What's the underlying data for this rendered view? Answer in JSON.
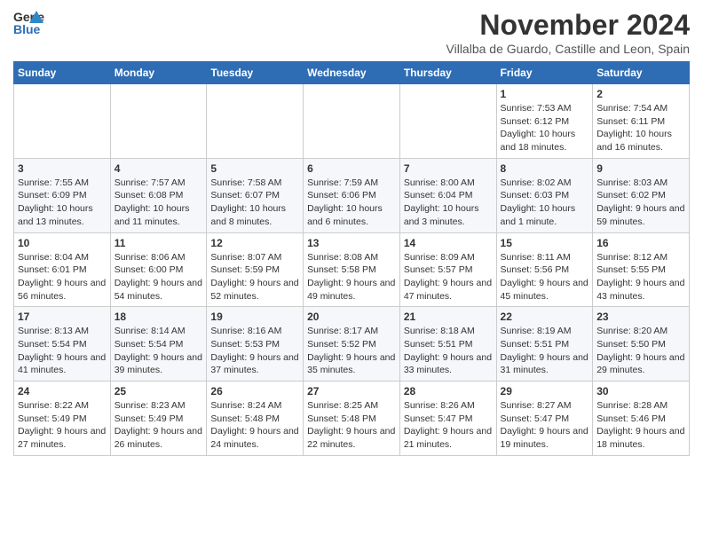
{
  "header": {
    "logo_general": "General",
    "logo_blue": "Blue",
    "title": "November 2024",
    "subtitle": "Villalba de Guardo, Castille and Leon, Spain"
  },
  "calendar": {
    "weekdays": [
      "Sunday",
      "Monday",
      "Tuesday",
      "Wednesday",
      "Thursday",
      "Friday",
      "Saturday"
    ],
    "weeks": [
      [
        {
          "day": "",
          "info": ""
        },
        {
          "day": "",
          "info": ""
        },
        {
          "day": "",
          "info": ""
        },
        {
          "day": "",
          "info": ""
        },
        {
          "day": "",
          "info": ""
        },
        {
          "day": "1",
          "info": "Sunrise: 7:53 AM\nSunset: 6:12 PM\nDaylight: 10 hours and 18 minutes."
        },
        {
          "day": "2",
          "info": "Sunrise: 7:54 AM\nSunset: 6:11 PM\nDaylight: 10 hours and 16 minutes."
        }
      ],
      [
        {
          "day": "3",
          "info": "Sunrise: 7:55 AM\nSunset: 6:09 PM\nDaylight: 10 hours and 13 minutes."
        },
        {
          "day": "4",
          "info": "Sunrise: 7:57 AM\nSunset: 6:08 PM\nDaylight: 10 hours and 11 minutes."
        },
        {
          "day": "5",
          "info": "Sunrise: 7:58 AM\nSunset: 6:07 PM\nDaylight: 10 hours and 8 minutes."
        },
        {
          "day": "6",
          "info": "Sunrise: 7:59 AM\nSunset: 6:06 PM\nDaylight: 10 hours and 6 minutes."
        },
        {
          "day": "7",
          "info": "Sunrise: 8:00 AM\nSunset: 6:04 PM\nDaylight: 10 hours and 3 minutes."
        },
        {
          "day": "8",
          "info": "Sunrise: 8:02 AM\nSunset: 6:03 PM\nDaylight: 10 hours and 1 minute."
        },
        {
          "day": "9",
          "info": "Sunrise: 8:03 AM\nSunset: 6:02 PM\nDaylight: 9 hours and 59 minutes."
        }
      ],
      [
        {
          "day": "10",
          "info": "Sunrise: 8:04 AM\nSunset: 6:01 PM\nDaylight: 9 hours and 56 minutes."
        },
        {
          "day": "11",
          "info": "Sunrise: 8:06 AM\nSunset: 6:00 PM\nDaylight: 9 hours and 54 minutes."
        },
        {
          "day": "12",
          "info": "Sunrise: 8:07 AM\nSunset: 5:59 PM\nDaylight: 9 hours and 52 minutes."
        },
        {
          "day": "13",
          "info": "Sunrise: 8:08 AM\nSunset: 5:58 PM\nDaylight: 9 hours and 49 minutes."
        },
        {
          "day": "14",
          "info": "Sunrise: 8:09 AM\nSunset: 5:57 PM\nDaylight: 9 hours and 47 minutes."
        },
        {
          "day": "15",
          "info": "Sunrise: 8:11 AM\nSunset: 5:56 PM\nDaylight: 9 hours and 45 minutes."
        },
        {
          "day": "16",
          "info": "Sunrise: 8:12 AM\nSunset: 5:55 PM\nDaylight: 9 hours and 43 minutes."
        }
      ],
      [
        {
          "day": "17",
          "info": "Sunrise: 8:13 AM\nSunset: 5:54 PM\nDaylight: 9 hours and 41 minutes."
        },
        {
          "day": "18",
          "info": "Sunrise: 8:14 AM\nSunset: 5:54 PM\nDaylight: 9 hours and 39 minutes."
        },
        {
          "day": "19",
          "info": "Sunrise: 8:16 AM\nSunset: 5:53 PM\nDaylight: 9 hours and 37 minutes."
        },
        {
          "day": "20",
          "info": "Sunrise: 8:17 AM\nSunset: 5:52 PM\nDaylight: 9 hours and 35 minutes."
        },
        {
          "day": "21",
          "info": "Sunrise: 8:18 AM\nSunset: 5:51 PM\nDaylight: 9 hours and 33 minutes."
        },
        {
          "day": "22",
          "info": "Sunrise: 8:19 AM\nSunset: 5:51 PM\nDaylight: 9 hours and 31 minutes."
        },
        {
          "day": "23",
          "info": "Sunrise: 8:20 AM\nSunset: 5:50 PM\nDaylight: 9 hours and 29 minutes."
        }
      ],
      [
        {
          "day": "24",
          "info": "Sunrise: 8:22 AM\nSunset: 5:49 PM\nDaylight: 9 hours and 27 minutes."
        },
        {
          "day": "25",
          "info": "Sunrise: 8:23 AM\nSunset: 5:49 PM\nDaylight: 9 hours and 26 minutes."
        },
        {
          "day": "26",
          "info": "Sunrise: 8:24 AM\nSunset: 5:48 PM\nDaylight: 9 hours and 24 minutes."
        },
        {
          "day": "27",
          "info": "Sunrise: 8:25 AM\nSunset: 5:48 PM\nDaylight: 9 hours and 22 minutes."
        },
        {
          "day": "28",
          "info": "Sunrise: 8:26 AM\nSunset: 5:47 PM\nDaylight: 9 hours and 21 minutes."
        },
        {
          "day": "29",
          "info": "Sunrise: 8:27 AM\nSunset: 5:47 PM\nDaylight: 9 hours and 19 minutes."
        },
        {
          "day": "30",
          "info": "Sunrise: 8:28 AM\nSunset: 5:46 PM\nDaylight: 9 hours and 18 minutes."
        }
      ]
    ]
  }
}
